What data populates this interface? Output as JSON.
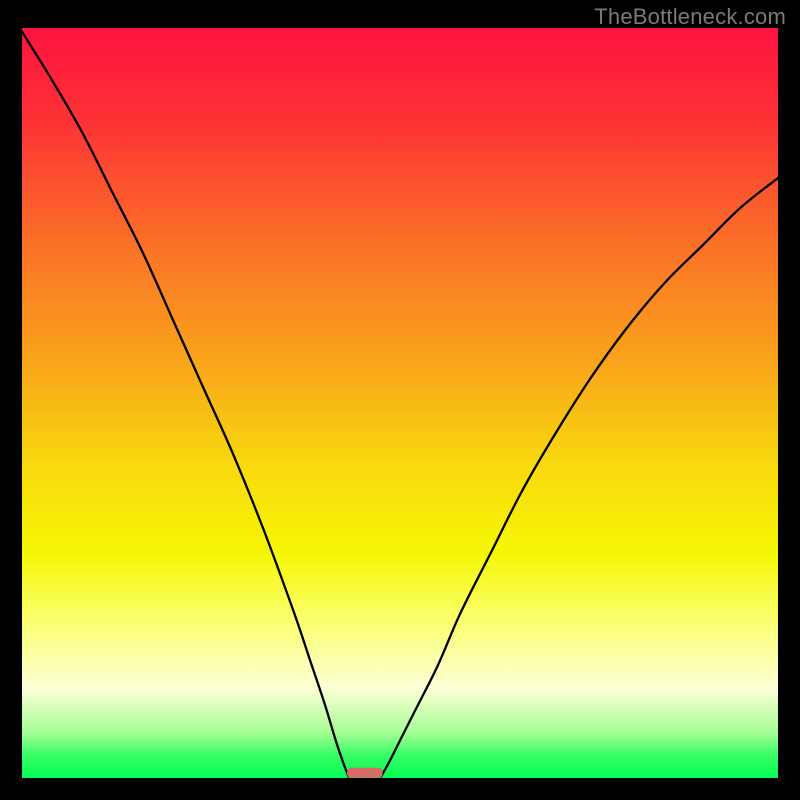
{
  "watermark": "TheBottleneck.com",
  "chart_data": {
    "type": "line",
    "title": "",
    "xlabel": "",
    "ylabel": "",
    "xlim": [
      0,
      100
    ],
    "ylim": [
      0,
      100
    ],
    "background_gradient": {
      "stops": [
        {
          "offset": 0.0,
          "color": "#fd1440"
        },
        {
          "offset": 0.12,
          "color": "#fd3035"
        },
        {
          "offset": 0.28,
          "color": "#fb6e28"
        },
        {
          "offset": 0.45,
          "color": "#f9a61a"
        },
        {
          "offset": 0.58,
          "color": "#f8d80e"
        },
        {
          "offset": 0.7,
          "color": "#f6f704"
        },
        {
          "offset": 0.78,
          "color": "#faff63"
        },
        {
          "offset": 0.88,
          "color": "#fcffd6"
        },
        {
          "offset": 0.94,
          "color": "#a4fe94"
        },
        {
          "offset": 0.97,
          "color": "#37fd63"
        },
        {
          "offset": 1.0,
          "color": "#02fd55"
        }
      ]
    },
    "series": [
      {
        "name": "left-curve",
        "stroke": "#000000",
        "x": [
          0,
          4,
          8,
          12,
          16,
          20,
          24,
          28,
          32,
          36,
          38,
          40,
          41.5,
          42.5,
          43.2
        ],
        "values": [
          99.5,
          93,
          86,
          78,
          70,
          61,
          52,
          43,
          33,
          22,
          16,
          10,
          5,
          2,
          0.2
        ]
      },
      {
        "name": "right-curve",
        "stroke": "#000000",
        "x": [
          47.5,
          48.5,
          50,
          52,
          55,
          58,
          62,
          66,
          70,
          75,
          80,
          85,
          90,
          95,
          100
        ],
        "values": [
          0.2,
          2,
          5,
          9,
          15,
          22,
          30,
          38,
          45,
          53,
          60,
          66,
          71,
          76,
          80
        ]
      }
    ],
    "baseline_marker": {
      "x_start": 43.0,
      "x_end": 47.7,
      "y": 0.7,
      "thickness": 10,
      "color": "#d76b68"
    }
  }
}
